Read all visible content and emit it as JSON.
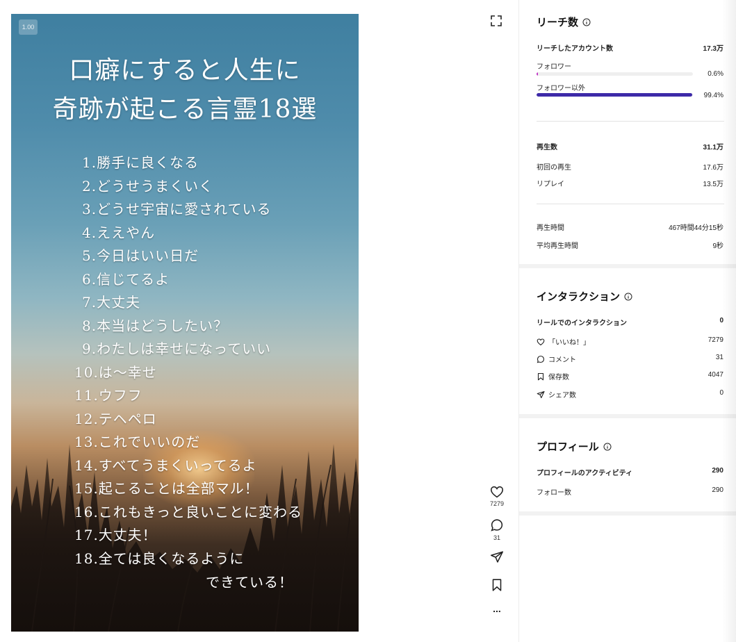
{
  "video": {
    "speed_badge": "1.00",
    "title_line1": "口癖にすると人生に",
    "title_line2": "奇跡が起こる言霊18選",
    "phrases": [
      "1.勝手に良くなる",
      "2.どうせうまくいく",
      "3.どうせ宇宙に愛されている",
      "4.ええやん",
      "5.今日はいい日だ",
      "6.信じてるよ",
      "7.大丈夫",
      "8.本当はどうしたい？",
      "9.わたしは幸せになっていい",
      "10.は〜幸せ",
      "11.ウフフ",
      "12.テヘペロ",
      "13.これでいいのだ",
      "14.すべてうまくいってるよ",
      "15.起こることは全部マル！",
      "16.これもきっと良いことに変わる",
      "17.大丈夫！",
      "18.全ては良くなるように"
    ],
    "phrase_last_cont": "できている！"
  },
  "rail": {
    "likes_count": "7279",
    "comments_count": "31",
    "icons": [
      "expand-icon",
      "heart-icon",
      "comment-icon",
      "share-icon",
      "bookmark-icon",
      "more-icon"
    ],
    "more_label": "..."
  },
  "insights": {
    "reach": {
      "title": "リーチ数",
      "accounts_label": "リーチしたアカウント数",
      "accounts_value": "17.3万",
      "followers_label": "フォロワー",
      "followers_value": "0.6%",
      "followers_fraction": 0.006,
      "non_followers_label": "フォロワー以外",
      "non_followers_value": "99.4%",
      "non_followers_fraction": 0.994,
      "plays_label": "再生数",
      "plays_value": "31.1万",
      "initial_plays_label": "初回の再生",
      "initial_plays_value": "17.6万",
      "replays_label": "リプレイ",
      "replays_value": "13.5万",
      "watch_time_label": "再生時間",
      "watch_time_value": "467時間44分15秒",
      "avg_watch_label": "平均再生時間",
      "avg_watch_value": "9秒"
    },
    "interactions": {
      "title": "インタラクション",
      "total_label": "リールでのインタラクション",
      "total_value": "0",
      "likes_label": "「いいね！」",
      "likes_value": "7279",
      "comments_label": "コメント",
      "comments_value": "31",
      "saves_label": "保存数",
      "saves_value": "4047",
      "shares_label": "シェア数",
      "shares_value": "0"
    },
    "profile": {
      "title": "プロフィール",
      "activity_label": "プロフィールのアクティビティ",
      "activity_value": "290",
      "follows_label": "フォロー数",
      "follows_value": "290"
    }
  },
  "colors": {
    "follower_bar": "#c034c4",
    "non_follower_bar": "#3d2aa8"
  }
}
